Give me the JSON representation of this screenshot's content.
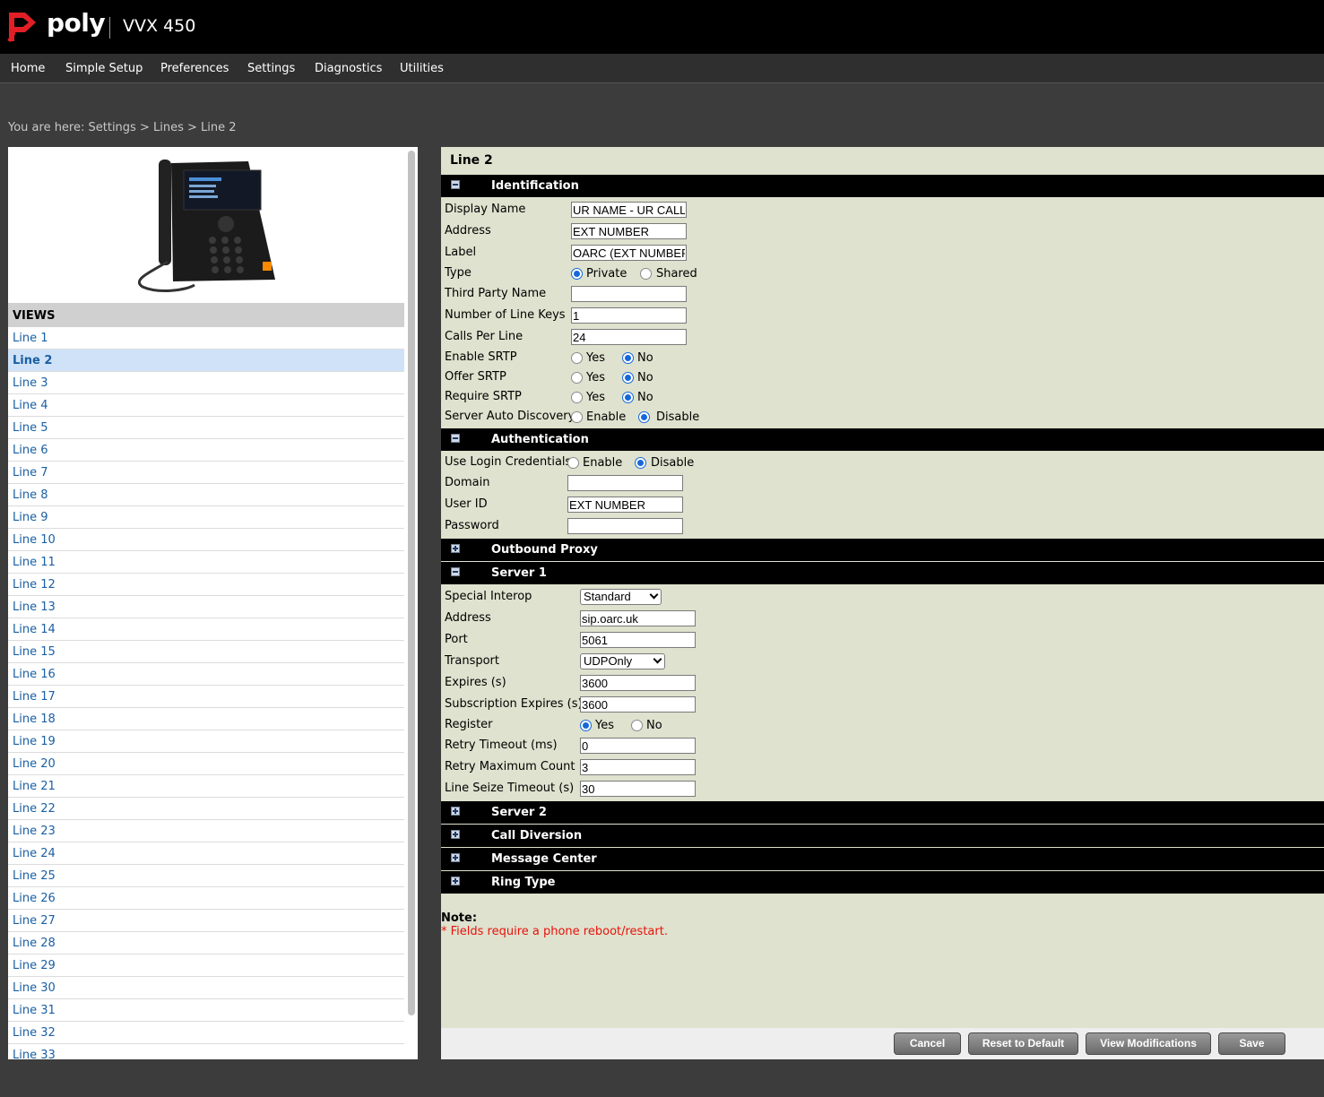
{
  "header": {
    "brand": "poly",
    "model": "VVX 450"
  },
  "nav": {
    "items": [
      "Home",
      "Simple Setup",
      "Preferences",
      "Settings",
      "Diagnostics",
      "Utilities"
    ]
  },
  "breadcrumb": "You are here: Settings > Lines > Line 2",
  "sidebar": {
    "views_heading": "VIEWS",
    "active": "Line 2",
    "items": [
      "Line 1",
      "Line 2",
      "Line 3",
      "Line 4",
      "Line 5",
      "Line 6",
      "Line 7",
      "Line 8",
      "Line 9",
      "Line 10",
      "Line 11",
      "Line 12",
      "Line 13",
      "Line 14",
      "Line 15",
      "Line 16",
      "Line 17",
      "Line 18",
      "Line 19",
      "Line 20",
      "Line 21",
      "Line 22",
      "Line 23",
      "Line 24",
      "Line 25",
      "Line 26",
      "Line 27",
      "Line 28",
      "Line 29",
      "Line 30",
      "Line 31",
      "Line 32",
      "Line 33"
    ]
  },
  "main": {
    "title": "Line 2",
    "identification": {
      "heading": "Identification",
      "display_name_label": "Display Name",
      "display_name": "UR NAME - UR CALL",
      "address_label": "Address",
      "address": "EXT NUMBER",
      "label_label": "Label",
      "label": "OARC (EXT NUMBER)",
      "type_label": "Type",
      "type_private": "Private",
      "type_shared": "Shared",
      "type_selected": "Private",
      "third_party_label": "Third Party Name",
      "third_party": "",
      "line_keys_label": "Number of Line Keys",
      "line_keys": "1",
      "calls_per_line_label": "Calls Per Line",
      "calls_per_line": "24",
      "enable_srtp_label": "Enable SRTP",
      "offer_srtp_label": "Offer SRTP",
      "require_srtp_label": "Require SRTP",
      "yes": "Yes",
      "no": "No",
      "server_auto_label": "Server Auto Discovery",
      "enable": "Enable",
      "disable": "Disable"
    },
    "authentication": {
      "heading": "Authentication",
      "use_login_label": "Use Login Credentials",
      "enable": "Enable",
      "disable": "Disable",
      "domain_label": "Domain",
      "domain": "",
      "user_id_label": "User ID",
      "user_id": "EXT NUMBER",
      "password_label": "Password",
      "password": ""
    },
    "outbound_proxy": {
      "heading": "Outbound Proxy"
    },
    "server1": {
      "heading": "Server 1",
      "interop_label": "Special Interop",
      "interop": "Standard",
      "address_label": "Address",
      "address": "sip.oarc.uk",
      "port_label": "Port",
      "port": "5061",
      "transport_label": "Transport",
      "transport": "UDPOnly",
      "expires_label": "Expires (s)",
      "expires": "3600",
      "sub_expires_label": "Subscription Expires (s)",
      "sub_expires": "3600",
      "register_label": "Register",
      "yes": "Yes",
      "no": "No",
      "retry_timeout_label": "Retry Timeout (ms)",
      "retry_timeout": "0",
      "retry_max_label": "Retry Maximum Count",
      "retry_max": "3",
      "seize_label": "Line Seize Timeout (s)",
      "seize": "30"
    },
    "collapsed_sections": [
      "Server 2",
      "Call Diversion",
      "Message Center",
      "Ring Type"
    ],
    "note_title": "Note:",
    "note_text": "* Fields require a phone reboot/restart."
  },
  "buttons": {
    "cancel": "Cancel",
    "reset": "Reset to Default",
    "view_mods": "View Modifications",
    "save": "Save"
  },
  "colors": {
    "accent_link": "#1a5fa3",
    "panel_bg": "#dee2ce",
    "note_red": "#e8120c",
    "brand_red": "#e21f26"
  }
}
